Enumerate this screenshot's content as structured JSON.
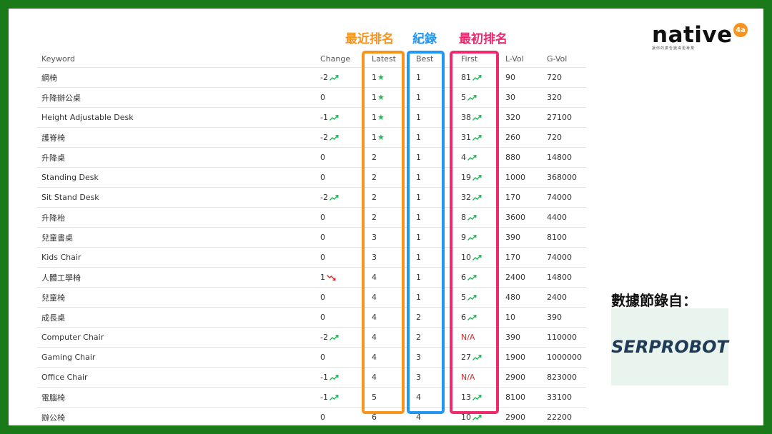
{
  "labels": {
    "latest": "最近排名",
    "best": "紀錄",
    "first": "最初排名"
  },
  "headers": {
    "keyword": "Keyword",
    "change": "Change",
    "latest": "Latest",
    "best": "Best",
    "first": "First",
    "lvol": "L-Vol",
    "gvol": "G-Vol"
  },
  "rows": [
    {
      "keyword": "網椅",
      "change": "-2",
      "change_trend": "up",
      "latest": "1",
      "latest_star": true,
      "best": "1",
      "first": "81",
      "first_trend": "up",
      "lvol": "90",
      "gvol": "720"
    },
    {
      "keyword": "升降辦公桌",
      "change": "0",
      "change_trend": "",
      "latest": "1",
      "latest_star": true,
      "best": "1",
      "first": "5",
      "first_trend": "up",
      "lvol": "30",
      "gvol": "320"
    },
    {
      "keyword": "Height Adjustable Desk",
      "change": "-1",
      "change_trend": "up",
      "latest": "1",
      "latest_star": true,
      "best": "1",
      "first": "38",
      "first_trend": "up",
      "lvol": "320",
      "gvol": "27100"
    },
    {
      "keyword": "護脊椅",
      "change": "-2",
      "change_trend": "up",
      "latest": "1",
      "latest_star": true,
      "best": "1",
      "first": "31",
      "first_trend": "up",
      "lvol": "260",
      "gvol": "720"
    },
    {
      "keyword": "升降桌",
      "change": "0",
      "change_trend": "",
      "latest": "2",
      "latest_star": false,
      "best": "1",
      "first": "4",
      "first_trend": "up",
      "lvol": "880",
      "gvol": "14800"
    },
    {
      "keyword": "Standing Desk",
      "change": "0",
      "change_trend": "",
      "latest": "2",
      "latest_star": false,
      "best": "1",
      "first": "19",
      "first_trend": "up",
      "lvol": "1000",
      "gvol": "368000"
    },
    {
      "keyword": "Sit Stand Desk",
      "change": "-2",
      "change_trend": "up",
      "latest": "2",
      "latest_star": false,
      "best": "1",
      "first": "32",
      "first_trend": "up",
      "lvol": "170",
      "gvol": "74000"
    },
    {
      "keyword": "升降枱",
      "change": "0",
      "change_trend": "",
      "latest": "2",
      "latest_star": false,
      "best": "1",
      "first": "8",
      "first_trend": "up",
      "lvol": "3600",
      "gvol": "4400"
    },
    {
      "keyword": "兒童書桌",
      "change": "0",
      "change_trend": "",
      "latest": "3",
      "latest_star": false,
      "best": "1",
      "first": "9",
      "first_trend": "up",
      "lvol": "390",
      "gvol": "8100"
    },
    {
      "keyword": "Kids Chair",
      "change": "0",
      "change_trend": "",
      "latest": "3",
      "latest_star": false,
      "best": "1",
      "first": "10",
      "first_trend": "up",
      "lvol": "170",
      "gvol": "74000"
    },
    {
      "keyword": "人體工學椅",
      "change": "1",
      "change_trend": "down",
      "latest": "4",
      "latest_star": false,
      "best": "1",
      "first": "6",
      "first_trend": "up",
      "lvol": "2400",
      "gvol": "14800"
    },
    {
      "keyword": "兒童椅",
      "change": "0",
      "change_trend": "",
      "latest": "4",
      "latest_star": false,
      "best": "1",
      "first": "5",
      "first_trend": "up",
      "lvol": "480",
      "gvol": "2400"
    },
    {
      "keyword": "成長桌",
      "change": "0",
      "change_trend": "",
      "latest": "4",
      "latest_star": false,
      "best": "2",
      "first": "6",
      "first_trend": "up",
      "lvol": "10",
      "gvol": "390"
    },
    {
      "keyword": "Computer Chair",
      "change": "-2",
      "change_trend": "up",
      "latest": "4",
      "latest_star": false,
      "best": "2",
      "first": "N/A",
      "first_trend": "",
      "lvol": "390",
      "gvol": "110000"
    },
    {
      "keyword": "Gaming Chair",
      "change": "0",
      "change_trend": "",
      "latest": "4",
      "latest_star": false,
      "best": "3",
      "first": "27",
      "first_trend": "up",
      "lvol": "1900",
      "gvol": "1000000"
    },
    {
      "keyword": "Office Chair",
      "change": "-1",
      "change_trend": "up",
      "latest": "4",
      "latest_star": false,
      "best": "3",
      "first": "N/A",
      "first_trend": "",
      "lvol": "2900",
      "gvol": "823000"
    },
    {
      "keyword": "電腦椅",
      "change": "-1",
      "change_trend": "up",
      "latest": "5",
      "latest_star": false,
      "best": "4",
      "first": "13",
      "first_trend": "up",
      "lvol": "8100",
      "gvol": "33100"
    },
    {
      "keyword": "辦公椅",
      "change": "0",
      "change_trend": "",
      "latest": "6",
      "latest_star": false,
      "best": "4",
      "first": "10",
      "first_trend": "up",
      "lvol": "2900",
      "gvol": "22200"
    }
  ],
  "logo": {
    "word": "native",
    "badge": "4a",
    "tagline": "讓你的廣告變得更專業"
  },
  "source": {
    "label": "數據節錄自：",
    "name": "SERPROBOT"
  },
  "colors": {
    "latest": "#f7941d",
    "best": "#2196f3",
    "first": "#ee2a6f",
    "trend_up": "#1db954",
    "trend_down": "#d42a2a",
    "frame": "#1a7a1a"
  }
}
